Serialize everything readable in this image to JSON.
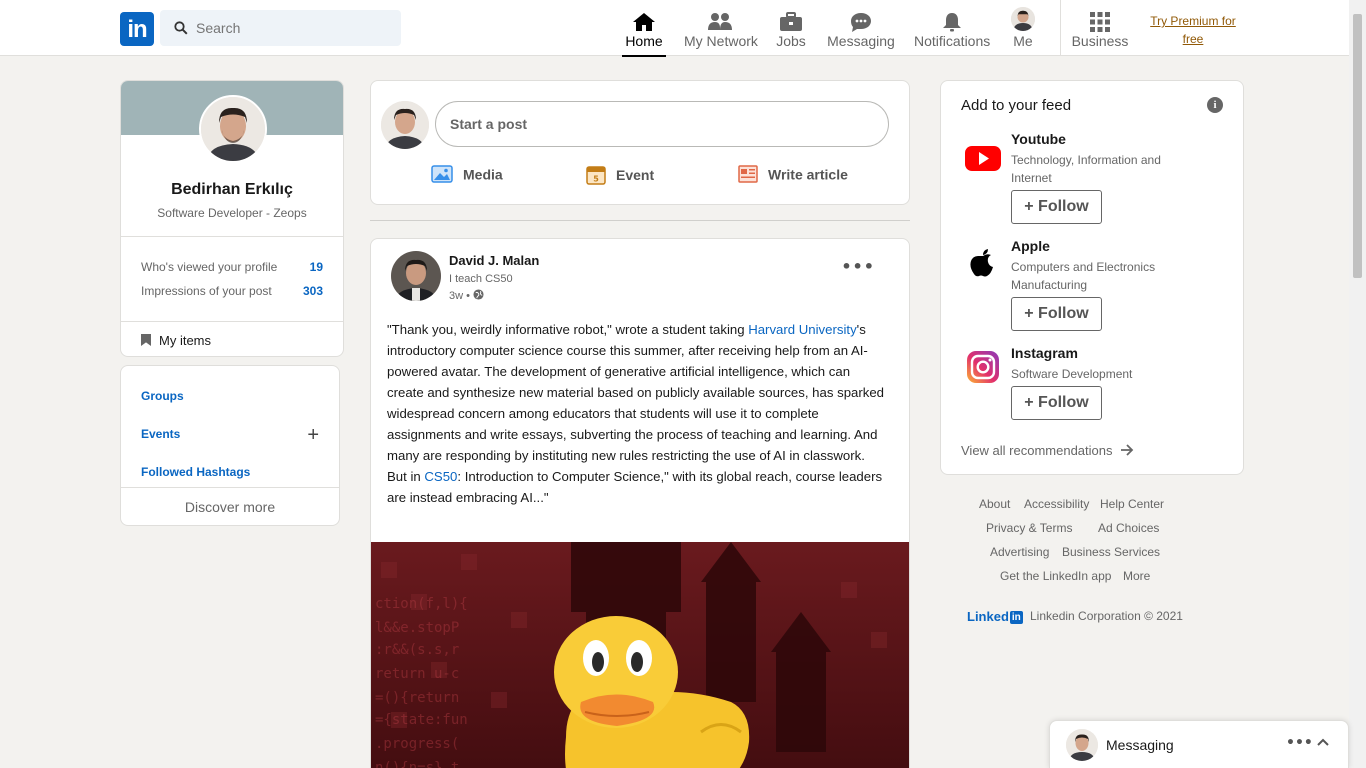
{
  "header": {
    "logo_text": "in",
    "search_placeholder": "Search",
    "nav": [
      {
        "label": "Home",
        "icon": "home-icon",
        "active": true
      },
      {
        "label": "My Network",
        "icon": "network-icon"
      },
      {
        "label": "Jobs",
        "icon": "briefcase-icon"
      },
      {
        "label": "Messaging",
        "icon": "chat-icon"
      },
      {
        "label": "Notifications",
        "icon": "bell-icon"
      },
      {
        "label": "Me",
        "icon": "avatar-icon"
      },
      {
        "label": "Business",
        "icon": "grid-icon"
      }
    ],
    "premium_line1": "Try Premium for",
    "premium_line2": "free"
  },
  "profile": {
    "name": "Bedirhan Erkılıç",
    "headline": "Software Developer - Zeops",
    "stats": [
      {
        "label": "Who's viewed your profile",
        "value": "19"
      },
      {
        "label": "Impressions of your post",
        "value": "303"
      }
    ],
    "my_items": "My items"
  },
  "shortcuts": {
    "groups": "Groups",
    "events": "Events",
    "hashtags": "Followed Hashtags",
    "discover": "Discover more"
  },
  "composer": {
    "placeholder": "Start a post",
    "actions": [
      {
        "label": "Media",
        "icon": "image-icon",
        "color": "#378fe9"
      },
      {
        "label": "Event",
        "icon": "calendar-icon",
        "color": "#c37d16"
      },
      {
        "label": "Write article",
        "icon": "article-icon",
        "color": "#e06847"
      }
    ]
  },
  "post": {
    "author": "David J. Malan",
    "subline": "I teach CS50",
    "time": "3w •",
    "body_1": "\"Thank you, weirdly informative robot,\" wrote a student taking ",
    "link_1": "Harvard University",
    "body_2": "'s introductory computer science course this summer, after receiving help from an AI-powered avatar. The development of generative artificial intelligence, which can create and synthesize new material based on publicly available sources, has sparked widespread concern among educators that students will use it to complete assignments and write essays, subverting the process of teaching and learning. And many are responding by instituting new rules restricting the use of AI in classwork. But in ",
    "link_2": "CS50",
    "body_3": ": Introduction to Computer Science,\" with its global reach, course leaders are instead embracing AI...\""
  },
  "feed": {
    "title": "Add to your feed",
    "recommendations": [
      {
        "name": "Youtube",
        "desc": "Technology, Information and Internet",
        "icon": "youtube-icon"
      },
      {
        "name": "Apple",
        "desc": "Computers and Electronics Manufacturing",
        "icon": "apple-icon"
      },
      {
        "name": "Instagram",
        "desc": "Software Development",
        "icon": "instagram-icon"
      }
    ],
    "follow_label": "+ Follow",
    "view_all": "View all recommendations"
  },
  "footer": {
    "links": [
      "About",
      "Accessibility",
      "Help Center",
      "Privacy & Terms",
      "Ad Choices",
      "Advertising",
      "Business Services",
      "Get the LinkedIn app",
      "More"
    ],
    "brand_text": "Linked",
    "brand_in": "in",
    "copyright": "Linkedin Corporation © 2021"
  },
  "messaging": {
    "label": "Messaging"
  },
  "colors": {
    "brand": "#0a66c2",
    "premium": "#915907",
    "youtube": "#ff0000"
  }
}
